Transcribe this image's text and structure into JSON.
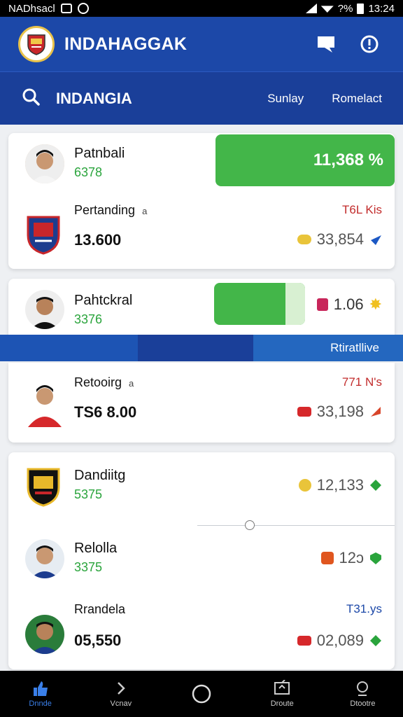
{
  "status": {
    "carrier": "NADhsacl",
    "battery": "?%",
    "time": "13:24"
  },
  "app": {
    "title": "INDAHAGGAK"
  },
  "search_bar": {
    "title": "INDANGIA",
    "link1": "Sunlay",
    "link2": "Romelact"
  },
  "card1": {
    "row1": {
      "name": "Patnbali",
      "sub": "6378",
      "pill": "11,368 %"
    },
    "row2": {
      "name": "Pertanding",
      "a": "a",
      "big": "13.600",
      "red": "T6L Kis",
      "value": "33,854"
    }
  },
  "card2": {
    "row1": {
      "name": "Pahtckral",
      "sub": "3376",
      "value": "1.06"
    },
    "band_label": "Rtiratllive"
  },
  "card3": {
    "row1": {
      "name": "Retooirg",
      "a": "a",
      "big": "TS6 8.00",
      "red": "771 N's",
      "value": "33,198"
    }
  },
  "card4": {
    "row1": {
      "name": "Dandiitg",
      "sub": "5375",
      "value": "12,133"
    },
    "row2": {
      "name": "Relolla",
      "sub": "3375",
      "value": "12ↄ"
    },
    "row3": {
      "name": "Rrandela",
      "big": "05,550",
      "blue": "T31.ys",
      "value": "02,089"
    }
  },
  "nav": {
    "item1": "Dnnde",
    "item2": "Vcnav",
    "item4": "Droute",
    "item5": "Dtootre"
  },
  "colors": {
    "primary": "#1c48a8",
    "green": "#43b649",
    "red": "#c22b2b"
  }
}
